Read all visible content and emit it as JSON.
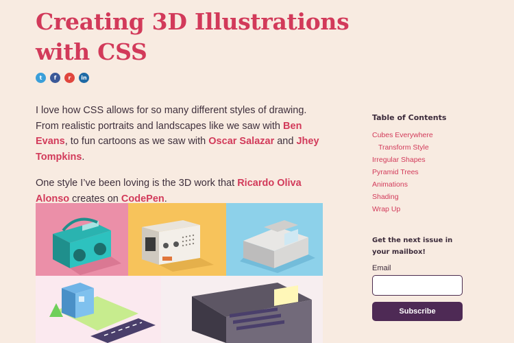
{
  "article": {
    "title": "Creating 3D Illustrations with CSS",
    "paragraph1": {
      "t1": "I love how CSS allows for so many different styles of drawing. From realistic portraits and landscapes like we saw with ",
      "link1": "Ben Evans",
      "t2": ", to fun cartoons as we saw with ",
      "link2": "Oscar Salazar",
      "t3": " and ",
      "link3": "Jhey Tompkins",
      "t4": "."
    },
    "paragraph2": {
      "t1": "One style I’ve been loving is the 3D work that ",
      "link1": "Ricardo Oliva Alonso",
      "t2": " creates on ",
      "link2": "CodePen",
      "t3": "."
    }
  },
  "social": {
    "twitter": "t",
    "facebook": "f",
    "reddit": "r",
    "linkedin": "in"
  },
  "sidebar": {
    "toc_title": "Table of Contents",
    "toc_items": [
      {
        "label": "Cubes Everywhere"
      },
      {
        "label": "Transform Style"
      },
      {
        "label": "Irregular Shapes"
      },
      {
        "label": "Pyramid Trees"
      },
      {
        "label": "Animations"
      },
      {
        "label": "Shading"
      },
      {
        "label": "Wrap Up"
      }
    ],
    "newsletter_title": "Get the next issue in your mailbox!",
    "email_label": "Email",
    "email_value": "",
    "subscribe_label": "Subscribe"
  },
  "colors": {
    "background": "#f8ebe1",
    "accent": "#d23a5a",
    "button": "#4e2a55"
  }
}
